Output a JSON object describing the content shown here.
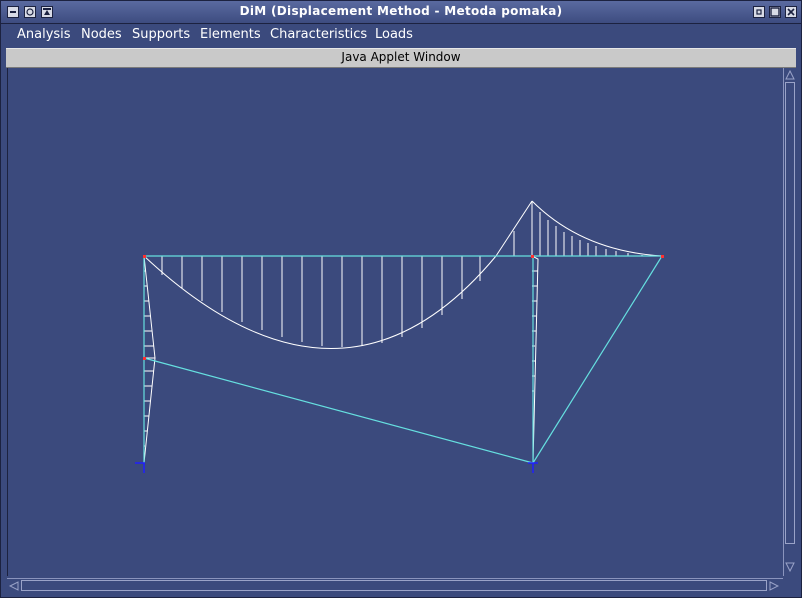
{
  "window": {
    "title": "DiM (Displacement Method - Metoda pomaka)"
  },
  "menu": {
    "items": [
      "Analysis",
      "Nodes",
      "Supports",
      "Elements",
      "Characteristics",
      "Loads"
    ]
  },
  "applet": {
    "label": "Java Applet Window"
  },
  "colors": {
    "background": "#3b4a7d",
    "element_line": "#66e0e0",
    "diagram_line": "#ffffff",
    "node": "#ff3030",
    "support": "#2020ff"
  }
}
